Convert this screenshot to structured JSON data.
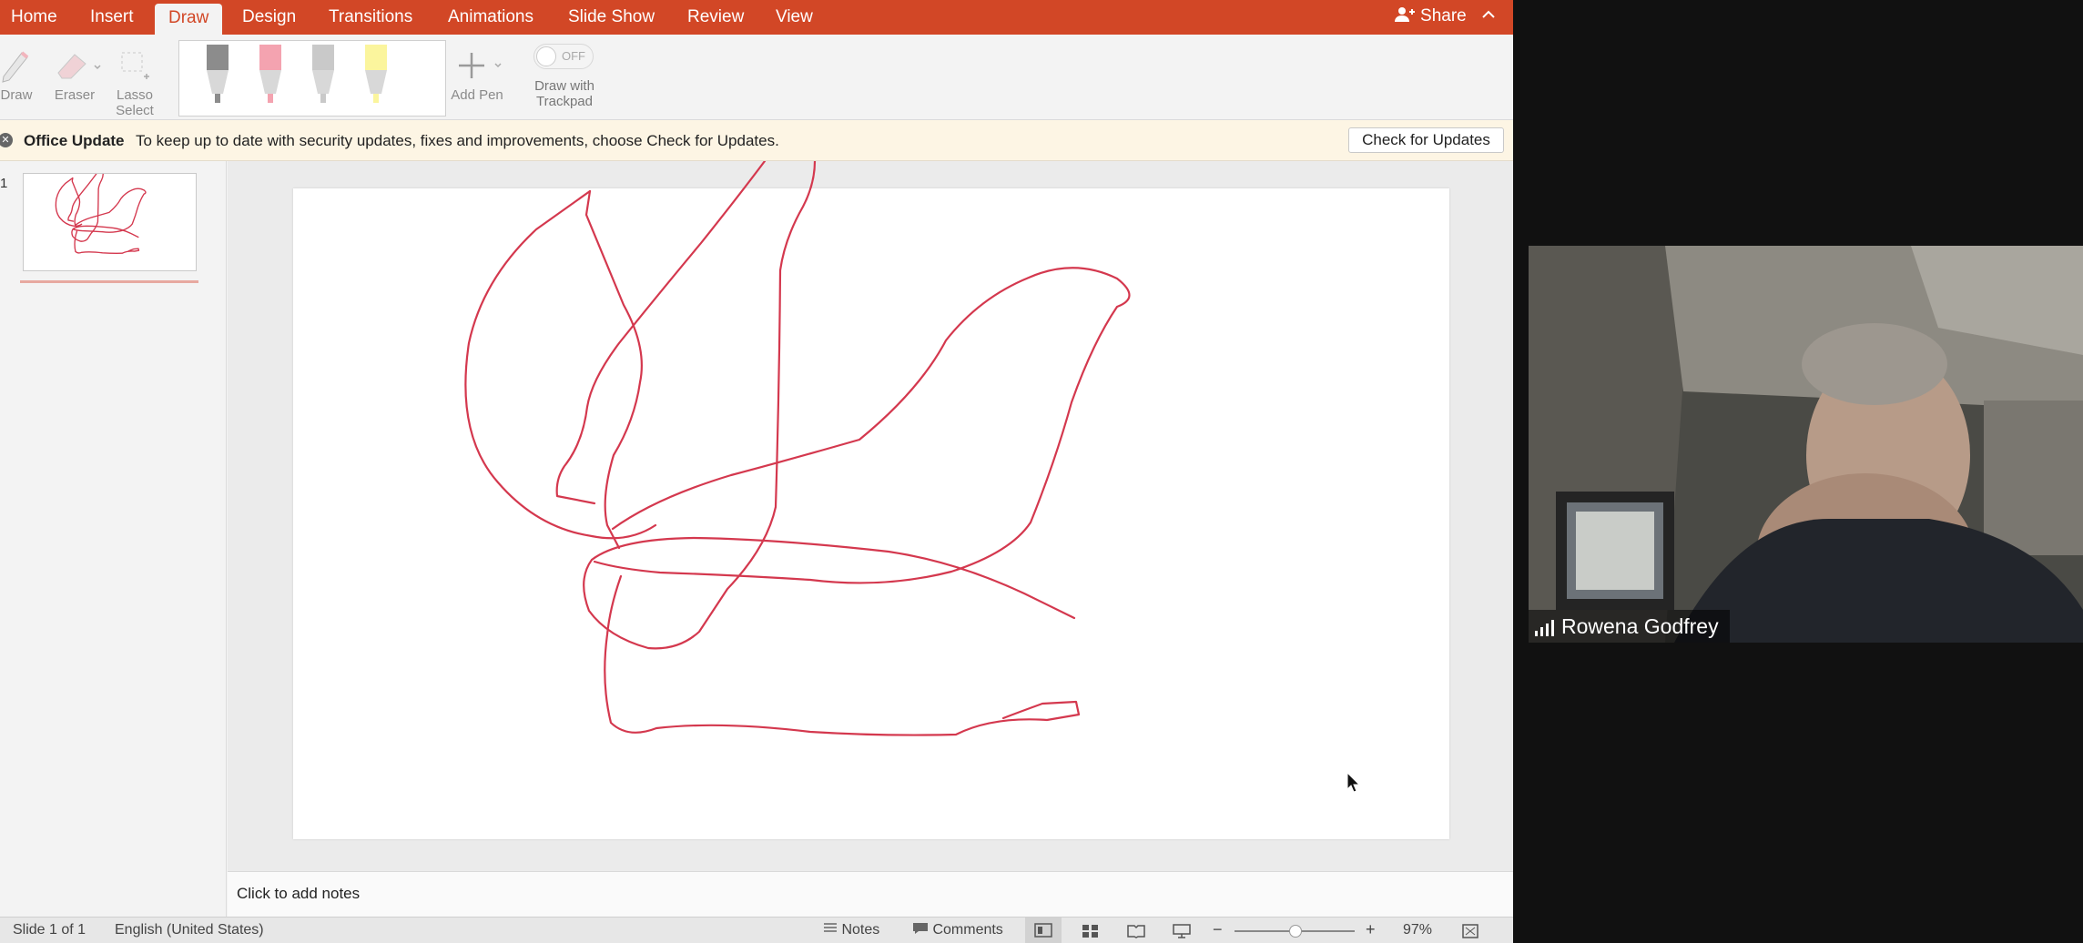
{
  "tabs": [
    "Home",
    "Insert",
    "Draw",
    "Design",
    "Transitions",
    "Animations",
    "Slide Show",
    "Review",
    "View"
  ],
  "active_tab": "Draw",
  "share_label": "Share",
  "ribbon": {
    "draw": "Draw",
    "eraser": "Eraser",
    "lasso_line1": "Lasso",
    "lasso_line2": "Select",
    "add_pen": "Add Pen",
    "toggle_state": "OFF",
    "trackpad_line1": "Draw with",
    "trackpad_line2": "Trackpad",
    "pen_colors": [
      "#8c8c8c",
      "#f4a3b0",
      "#c9c9c9",
      "#fbf59d"
    ]
  },
  "message_bar": {
    "title": "Office Update",
    "text": "To keep up to date with security updates, fixes and improvements, choose Check for Updates.",
    "button": "Check for Updates"
  },
  "thumbnail": {
    "number": "1"
  },
  "notes_placeholder": "Click to add notes",
  "status": {
    "slide": "Slide 1 of 1",
    "language": "English (United States)",
    "notes": "Notes",
    "comments": "Comments",
    "zoom": "97%"
  },
  "video": {
    "participant": "Rowena Godfrey"
  },
  "colors": {
    "brand": "#d24726",
    "ink": "#d4384e"
  }
}
